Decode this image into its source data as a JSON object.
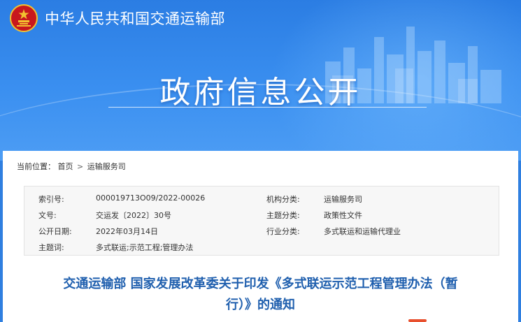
{
  "header": {
    "site_title": "中华人民共和国交通运输部",
    "banner_heading": "政府信息公开"
  },
  "breadcrumb": {
    "prefix": "当前位置：",
    "home": "首页",
    "separator": ">",
    "current": "运输服务司"
  },
  "meta": {
    "index_label": "索引号:",
    "index_value": "000019713O09/2022-00026",
    "org_label": "机构分类:",
    "org_value": "运输服务司",
    "doc_no_label": "文号:",
    "doc_no_value": "交运发〔2022〕30号",
    "topic_label": "主题分类:",
    "topic_value": "政策性文件",
    "date_label": "公开日期:",
    "date_value": "2022年03月14日",
    "industry_label": "行业分类:",
    "industry_value": "多式联运和运输代理业",
    "keywords_label": "主题词:",
    "keywords_value": "多式联运;示范工程;管理办法"
  },
  "document": {
    "title_line1": "交通运输部 国家发展改革委关于印发《多式联运示范工程管理办法（暂",
    "title_line2": "行）》的通知"
  },
  "colors": {
    "banner_blue": "#2f7fe0",
    "title_blue": "#1f5fae",
    "emblem_red": "#c8181e",
    "emblem_gold": "#f2c230"
  }
}
